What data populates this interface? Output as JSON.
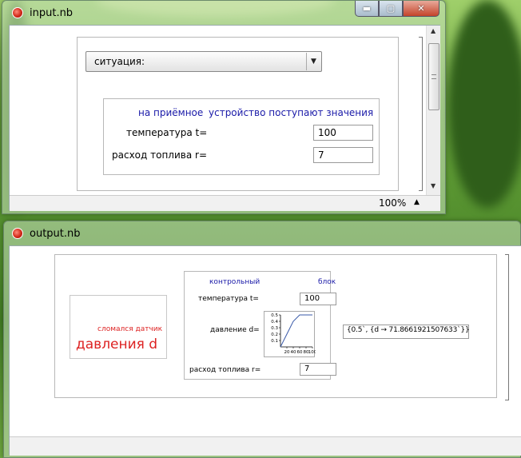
{
  "input_window": {
    "title": "input.nb",
    "dropdown_label": "ситуация:",
    "heading_part1": "на приёмное",
    "heading_part2": "устройство поступают значения",
    "temperature_label": "температура t=",
    "temperature_value": "100",
    "fuel_label": "расход топлива r=",
    "fuel_value": "7",
    "zoom": "100%"
  },
  "output_window": {
    "title": "output.nb",
    "error_small": "сломался датчик",
    "error_large": "давления d",
    "heading_left": "контрольный",
    "heading_right": "блок",
    "temperature_label": "температура t=",
    "temperature_value": "100",
    "pressure_label": "давление d=",
    "fuel_label": "расход топлива r=",
    "fuel_value": "7",
    "result": "{0.5`, {d → 71.8661921507633`}}"
  },
  "icons": {
    "minimize": "minimize-icon",
    "maximize": "maximize-icon",
    "close": "close-icon",
    "dropdown": "chevron-down-icon"
  },
  "chart_data": {
    "type": "line",
    "x": [
      0,
      20,
      40,
      60,
      80,
      100
    ],
    "values": [
      0.0,
      0.2,
      0.4,
      0.5,
      0.5,
      0.5
    ],
    "xticks": [
      "20",
      "40",
      "60",
      "80",
      "100"
    ],
    "yticks": [
      "0.1",
      "0.2",
      "0.3",
      "0.4",
      "0.5"
    ],
    "xlim": [
      0,
      100
    ],
    "ylim": [
      0,
      0.5
    ]
  }
}
